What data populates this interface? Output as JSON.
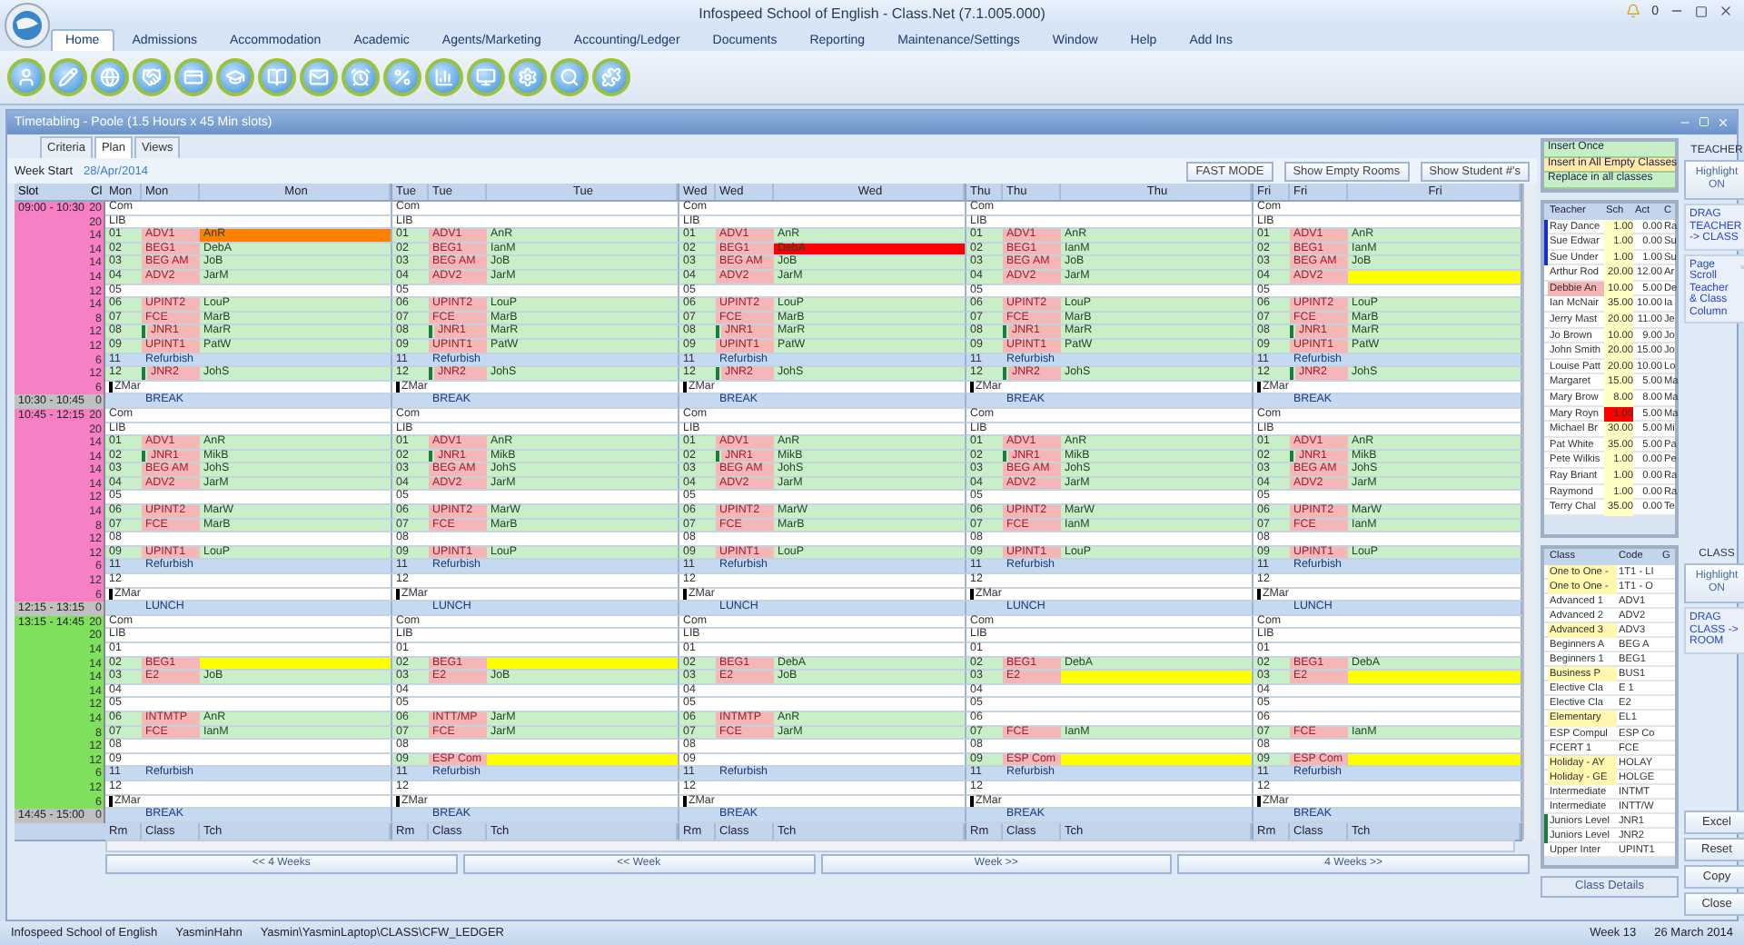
{
  "window": {
    "title": "Infospeed School of English - Class.Net (7.1.005.000)",
    "notification_count": "0"
  },
  "menu": [
    {
      "label": "Home",
      "selected": true
    },
    {
      "label": "Admissions",
      "selected": false
    },
    {
      "label": "Accommodation",
      "selected": false
    },
    {
      "label": "Academic",
      "selected": false
    },
    {
      "label": "Agents/Marketing",
      "selected": false
    },
    {
      "label": "Accounting/Ledger",
      "selected": false
    },
    {
      "label": "Documents",
      "selected": false
    },
    {
      "label": "Reporting",
      "selected": false
    },
    {
      "label": "Maintenance/Settings",
      "selected": false
    },
    {
      "label": "Window",
      "selected": false
    },
    {
      "label": "Help",
      "selected": false
    },
    {
      "label": "Add Ins",
      "selected": false
    }
  ],
  "timetable": {
    "title": "Timetabling - Poole (1.5 Hours x 45 Min slots)",
    "tabs": [
      {
        "label": "Criteria",
        "selected": false
      },
      {
        "label": "Plan",
        "selected": true
      },
      {
        "label": "Views",
        "selected": false
      }
    ],
    "week_start_label": "Week Start",
    "week_start": "28/Apr/2014",
    "buttons": [
      "FAST MODE",
      "Show Empty Rooms",
      "Show Student #'s"
    ],
    "slot_header": [
      "Slot",
      "Cl"
    ],
    "days": [
      {
        "headers": [
          "Mon",
          "Mon",
          "Mon"
        ],
        "footer": [
          "Rm",
          "Class",
          "Tch"
        ]
      },
      {
        "headers": [
          "Tue",
          "Tue",
          "Tue"
        ],
        "footer": [
          "Rm",
          "Class",
          "Tch"
        ]
      },
      {
        "headers": [
          "Wed",
          "Wed",
          "Wed"
        ],
        "footer": [
          "Rm",
          "Class",
          "Tch"
        ]
      },
      {
        "headers": [
          "Thu",
          "Thu",
          "Thu"
        ],
        "footer": [
          "Rm",
          "Class",
          "Tch"
        ]
      },
      {
        "headers": [
          "Fri",
          "Fri",
          "Fri"
        ],
        "footer": [
          "Rm",
          "Class",
          "Tch"
        ]
      }
    ],
    "slots": [
      {
        "time": "09:00 - 10:30",
        "color": "#f77fc4",
        "rows": [
          {
            "kind": "room",
            "cl": "20",
            "cells": [
              {
                "room": "Com"
              },
              {
                "room": "Com"
              },
              {
                "room": "Com"
              },
              {
                "room": "Com"
              },
              {
                "room": "Com"
              }
            ]
          },
          {
            "kind": "room",
            "cl": "20",
            "cells": [
              {
                "room": "LIB"
              },
              {
                "room": "LIB"
              },
              {
                "room": "LIB"
              },
              {
                "room": "LIB"
              },
              {
                "room": "LIB"
              }
            ]
          },
          {
            "kind": "room",
            "cl": "14",
            "cells": [
              {
                "room": "01",
                "class": "ADV1",
                "teacher": "AnR",
                "color": "#ff8000"
              },
              {
                "room": "01",
                "class": "ADV1",
                "teacher": "AnR"
              },
              {
                "room": "01",
                "class": "ADV1",
                "teacher": "AnR"
              },
              {
                "room": "01",
                "class": "ADV1",
                "teacher": "AnR"
              },
              {
                "room": "01",
                "class": "ADV1",
                "teacher": "AnR"
              }
            ]
          },
          {
            "kind": "room",
            "cl": "14",
            "cells": [
              {
                "room": "02",
                "class": "BEG1",
                "teacher": "DebA"
              },
              {
                "room": "02",
                "class": "BEG1",
                "teacher": "IanM"
              },
              {
                "room": "02",
                "class": "BEG1",
                "teacher": "DebA",
                "color": "#ff0000"
              },
              {
                "room": "02",
                "class": "BEG1",
                "teacher": "IanM"
              },
              {
                "room": "02",
                "class": "BEG1",
                "teacher": "IanM"
              }
            ]
          },
          {
            "kind": "room",
            "cl": "14",
            "cells": [
              {
                "room": "03",
                "class": "BEG AM",
                "teacher": "JoB"
              },
              {
                "room": "03",
                "class": "BEG AM",
                "teacher": "JoB"
              },
              {
                "room": "03",
                "class": "BEG AM",
                "teacher": "JoB"
              },
              {
                "room": "03",
                "class": "BEG AM",
                "teacher": "JoB"
              },
              {
                "room": "03",
                "class": "BEG AM",
                "teacher": "JoB"
              }
            ]
          },
          {
            "kind": "room",
            "cl": "14",
            "cells": [
              {
                "room": "04",
                "class": "ADV2",
                "teacher": "JarM"
              },
              {
                "room": "04",
                "class": "ADV2",
                "teacher": "JarM"
              },
              {
                "room": "04",
                "class": "ADV2",
                "teacher": "JarM"
              },
              {
                "room": "04",
                "class": "ADV2",
                "teacher": "JarM"
              },
              {
                "room": "04",
                "class": "ADV2",
                "color": "#ffff00"
              }
            ]
          },
          {
            "kind": "room",
            "cl": "12",
            "cells": [
              {
                "room": "05"
              },
              {
                "room": "05"
              },
              {
                "room": "05"
              },
              {
                "room": "05"
              },
              {
                "room": "05"
              }
            ]
          },
          {
            "kind": "room",
            "cl": "14",
            "cells": [
              {
                "room": "06",
                "class": "UPINT2",
                "teacher": "LouP"
              },
              {
                "room": "06",
                "class": "UPINT2",
                "teacher": "LouP"
              },
              {
                "room": "06",
                "class": "UPINT2",
                "teacher": "LouP"
              },
              {
                "room": "06",
                "class": "UPINT2",
                "teacher": "LouP"
              },
              {
                "room": "06",
                "class": "UPINT2",
                "teacher": "LouP"
              }
            ]
          },
          {
            "kind": "room",
            "cl": "8",
            "cells": [
              {
                "room": "07",
                "class": "FCE",
                "teacher": "MarB"
              },
              {
                "room": "07",
                "class": "FCE",
                "teacher": "MarB"
              },
              {
                "room": "07",
                "class": "FCE",
                "teacher": "MarB"
              },
              {
                "room": "07",
                "class": "FCE",
                "teacher": "MarB"
              },
              {
                "room": "07",
                "class": "FCE",
                "teacher": "MarB"
              }
            ]
          },
          {
            "kind": "room",
            "cl": "12",
            "cells": [
              {
                "room": "08",
                "class": "JNR1",
                "teacher": "MarR",
                "flagged": true
              },
              {
                "room": "08",
                "class": "JNR1",
                "teacher": "MarR",
                "flagged": true
              },
              {
                "room": "08",
                "class": "JNR1",
                "teacher": "MarR",
                "flagged": true
              },
              {
                "room": "08",
                "class": "JNR1",
                "teacher": "MarR",
                "flagged": true
              },
              {
                "room": "08",
                "class": "JNR1",
                "teacher": "MarR",
                "flagged": true
              }
            ]
          },
          {
            "kind": "room",
            "cl": "12",
            "cells": [
              {
                "room": "09",
                "class": "UPINT1",
                "teacher": "PatW"
              },
              {
                "room": "09",
                "class": "UPINT1",
                "teacher": "PatW"
              },
              {
                "room": "09",
                "class": "UPINT1",
                "teacher": "PatW"
              },
              {
                "room": "09",
                "class": "UPINT1",
                "teacher": "PatW"
              },
              {
                "room": "09",
                "class": "UPINT1",
                "teacher": "PatW"
              }
            ]
          },
          {
            "kind": "note",
            "cl": "6",
            "cells": [
              {
                "room": "11",
                "class": "Refurbish"
              },
              {
                "room": "11",
                "class": "Refurbish"
              },
              {
                "room": "11",
                "class": "Refurbish"
              },
              {
                "room": "11",
                "class": "Refurbish"
              },
              {
                "room": "11",
                "class": "Refurbish"
              }
            ]
          },
          {
            "kind": "room",
            "cl": "12",
            "cells": [
              {
                "room": "12",
                "class": "JNR2",
                "teacher": "JohS",
                "flagged": true
              },
              {
                "room": "12",
                "class": "JNR2",
                "teacher": "JohS",
                "flagged": true
              },
              {
                "room": "12",
                "class": "JNR2",
                "teacher": "JohS",
                "flagged": true
              },
              {
                "room": "12",
                "class": "JNR2",
                "teacher": "JohS",
                "flagged": true
              },
              {
                "room": "12",
                "class": "JNR2",
                "teacher": "JohS",
                "flagged": true
              }
            ]
          },
          {
            "kind": "room",
            "cl": "6",
            "cells": [
              {
                "room": "ZMar",
                "flagged": true
              },
              {
                "room": "ZMar",
                "flagged": true
              },
              {
                "room": "ZMar",
                "flagged": true
              },
              {
                "room": "ZMar",
                "flagged": true
              },
              {
                "room": "ZMar",
                "flagged": true
              }
            ]
          }
        ]
      },
      {
        "time": "10:30 - 10:45",
        "color": "#c0c0c0",
        "rows": [
          {
            "kind": "break",
            "cl": "0",
            "cells": [
              {
                "class": "BREAK"
              },
              {
                "class": "BREAK"
              },
              {
                "class": "BREAK"
              },
              {
                "class": "BREAK"
              },
              {
                "class": "BREAK"
              }
            ]
          }
        ]
      },
      {
        "time": "10:45 - 12:15",
        "color": "#f77fc4",
        "rows": [
          {
            "kind": "room",
            "cl": "20",
            "cells": [
              {
                "room": "Com"
              },
              {
                "room": "Com"
              },
              {
                "room": "Com"
              },
              {
                "room": "Com"
              },
              {
                "room": "Com"
              }
            ]
          },
          {
            "kind": "room",
            "cl": "20",
            "cells": [
              {
                "room": "LIB"
              },
              {
                "room": "LIB"
              },
              {
                "room": "LIB"
              },
              {
                "room": "LIB"
              },
              {
                "room": "LIB"
              }
            ]
          },
          {
            "kind": "room",
            "cl": "14",
            "cells": [
              {
                "room": "01",
                "class": "ADV1",
                "teacher": "AnR"
              },
              {
                "room": "01",
                "class": "ADV1",
                "teacher": "AnR"
              },
              {
                "room": "01",
                "class": "ADV1",
                "teacher": "AnR"
              },
              {
                "room": "01",
                "class": "ADV1",
                "teacher": "AnR"
              },
              {
                "room": "01",
                "class": "ADV1",
                "teacher": "AnR"
              }
            ]
          },
          {
            "kind": "room",
            "cl": "14",
            "cells": [
              {
                "room": "02",
                "class": "JNR1",
                "teacher": "MikB",
                "flagged": true
              },
              {
                "room": "02",
                "class": "JNR1",
                "teacher": "MikB",
                "flagged": true
              },
              {
                "room": "02",
                "class": "JNR1",
                "teacher": "MikB",
                "flagged": true
              },
              {
                "room": "02",
                "class": "JNR1",
                "teacher": "MikB",
                "flagged": true
              },
              {
                "room": "02",
                "class": "JNR1",
                "teacher": "MikB",
                "flagged": true
              }
            ]
          },
          {
            "kind": "room",
            "cl": "14",
            "cells": [
              {
                "room": "03",
                "class": "BEG AM",
                "teacher": "JohS"
              },
              {
                "room": "03",
                "class": "BEG AM",
                "teacher": "JohS"
              },
              {
                "room": "03",
                "class": "BEG AM",
                "teacher": "JohS"
              },
              {
                "room": "03",
                "class": "BEG AM",
                "teacher": "JohS"
              },
              {
                "room": "03",
                "class": "BEG AM",
                "teacher": "JohS"
              }
            ]
          },
          {
            "kind": "room",
            "cl": "14",
            "cells": [
              {
                "room": "04",
                "class": "ADV2",
                "teacher": "JarM"
              },
              {
                "room": "04",
                "class": "ADV2",
                "teacher": "JarM"
              },
              {
                "room": "04",
                "class": "ADV2",
                "teacher": "JarM"
              },
              {
                "room": "04",
                "class": "ADV2",
                "teacher": "JarM"
              },
              {
                "room": "04",
                "class": "ADV2",
                "teacher": "JarM"
              }
            ]
          },
          {
            "kind": "room",
            "cl": "12",
            "cells": [
              {
                "room": "05"
              },
              {
                "room": "05"
              },
              {
                "room": "05"
              },
              {
                "room": "05"
              },
              {
                "room": "05"
              }
            ]
          },
          {
            "kind": "room",
            "cl": "14",
            "cells": [
              {
                "room": "06",
                "class": "UPINT2",
                "teacher": "MarW"
              },
              {
                "room": "06",
                "class": "UPINT2",
                "teacher": "MarW"
              },
              {
                "room": "06",
                "class": "UPINT2",
                "teacher": "MarW"
              },
              {
                "room": "06",
                "class": "UPINT2",
                "teacher": "MarW"
              },
              {
                "room": "06",
                "class": "UPINT2",
                "teacher": "MarW"
              }
            ]
          },
          {
            "kind": "room",
            "cl": "8",
            "cells": [
              {
                "room": "07",
                "class": "FCE",
                "teacher": "MarB"
              },
              {
                "room": "07",
                "class": "FCE",
                "teacher": "MarB"
              },
              {
                "room": "07",
                "class": "FCE",
                "teacher": "MarB"
              },
              {
                "room": "07",
                "class": "FCE",
                "teacher": "IanM"
              },
              {
                "room": "07",
                "class": "FCE",
                "teacher": "IanM"
              }
            ]
          },
          {
            "kind": "room",
            "cl": "12",
            "cells": [
              {
                "room": "08"
              },
              {
                "room": "08"
              },
              {
                "room": "08"
              },
              {
                "room": "08"
              },
              {
                "room": "08"
              }
            ]
          },
          {
            "kind": "room",
            "cl": "12",
            "cells": [
              {
                "room": "09",
                "class": "UPINT1",
                "teacher": "LouP"
              },
              {
                "room": "09",
                "class": "UPINT1",
                "teacher": "LouP"
              },
              {
                "room": "09",
                "class": "UPINT1",
                "teacher": "LouP"
              },
              {
                "room": "09",
                "class": "UPINT1",
                "teacher": "LouP"
              },
              {
                "room": "09",
                "class": "UPINT1",
                "teacher": "LouP"
              }
            ]
          },
          {
            "kind": "note",
            "cl": "6",
            "cells": [
              {
                "room": "11",
                "class": "Refurbish"
              },
              {
                "room": "11",
                "class": "Refurbish"
              },
              {
                "room": "11",
                "class": "Refurbish"
              },
              {
                "room": "11",
                "class": "Refurbish"
              },
              {
                "room": "11",
                "class": "Refurbish"
              }
            ]
          },
          {
            "kind": "room",
            "cl": "12",
            "cells": [
              {
                "room": "12"
              },
              {
                "room": "12"
              },
              {
                "room": "12"
              },
              {
                "room": "12"
              },
              {
                "room": "12"
              }
            ]
          },
          {
            "kind": "room",
            "cl": "6",
            "cells": [
              {
                "room": "ZMar",
                "flagged": true
              },
              {
                "room": "ZMar",
                "flagged": true
              },
              {
                "room": "ZMar",
                "flagged": true
              },
              {
                "room": "ZMar",
                "flagged": true
              },
              {
                "room": "ZMar",
                "flagged": true
              }
            ]
          }
        ]
      },
      {
        "time": "12:15 - 13:15",
        "color": "#c0c0c0",
        "rows": [
          {
            "kind": "break",
            "cl": "0",
            "cells": [
              {
                "class": "LUNCH"
              },
              {
                "class": "LUNCH"
              },
              {
                "class": "LUNCH"
              },
              {
                "class": "LUNCH"
              },
              {
                "class": "LUNCH"
              }
            ]
          }
        ]
      },
      {
        "time": "13:15 - 14:45",
        "color": "#7ee05c",
        "rows": [
          {
            "kind": "room",
            "cl": "20",
            "cells": [
              {
                "room": "Com"
              },
              {
                "room": "Com"
              },
              {
                "room": "Com"
              },
              {
                "room": "Com"
              },
              {
                "room": "Com"
              }
            ]
          },
          {
            "kind": "room",
            "cl": "20",
            "cells": [
              {
                "room": "LIB"
              },
              {
                "room": "LIB"
              },
              {
                "room": "LIB"
              },
              {
                "room": "LIB"
              },
              {
                "room": "LIB"
              }
            ]
          },
          {
            "kind": "room",
            "cl": "14",
            "cells": [
              {
                "room": "01"
              },
              {
                "room": "01"
              },
              {
                "room": "01"
              },
              {
                "room": "01"
              },
              {
                "room": "01"
              }
            ]
          },
          {
            "kind": "room",
            "cl": "14",
            "cells": [
              {
                "room": "02",
                "class": "BEG1",
                "color": "#ffff00"
              },
              {
                "room": "02",
                "class": "BEG1",
                "color": "#ffff00"
              },
              {
                "room": "02",
                "class": "BEG1",
                "teacher": "DebA"
              },
              {
                "room": "02",
                "class": "BEG1",
                "teacher": "DebA"
              },
              {
                "room": "02",
                "class": "BEG1",
                "teacher": "DebA"
              }
            ]
          },
          {
            "kind": "room",
            "cl": "14",
            "cells": [
              {
                "room": "03",
                "class": "E2",
                "teacher": "JoB"
              },
              {
                "room": "03",
                "class": "E2",
                "teacher": "JoB"
              },
              {
                "room": "03",
                "class": "E2",
                "teacher": "JoB"
              },
              {
                "room": "03",
                "class": "E2",
                "color": "#ffff00"
              },
              {
                "room": "03",
                "class": "E2",
                "color": "#ffff00"
              }
            ]
          },
          {
            "kind": "room",
            "cl": "14",
            "cells": [
              {
                "room": "04"
              },
              {
                "room": "04"
              },
              {
                "room": "04"
              },
              {
                "room": "04"
              },
              {
                "room": "04"
              }
            ]
          },
          {
            "kind": "room",
            "cl": "12",
            "cells": [
              {
                "room": "05"
              },
              {
                "room": "05"
              },
              {
                "room": "05"
              },
              {
                "room": "05"
              },
              {
                "room": "05"
              }
            ]
          },
          {
            "kind": "room",
            "cl": "14",
            "cells": [
              {
                "room": "06",
                "class": "INTMTP",
                "teacher": "AnR"
              },
              {
                "room": "06",
                "class": "INTT/MP",
                "teacher": "JarM"
              },
              {
                "room": "06",
                "class": "INTMTP",
                "teacher": "AnR"
              },
              {
                "room": "06"
              },
              {
                "room": "06"
              }
            ]
          },
          {
            "kind": "room",
            "cl": "8",
            "cells": [
              {
                "room": "07",
                "class": "FCE",
                "teacher": "IanM"
              },
              {
                "room": "07",
                "class": "FCE",
                "teacher": "JarM"
              },
              {
                "room": "07",
                "class": "FCE",
                "teacher": "JarM"
              },
              {
                "room": "07",
                "class": "FCE",
                "teacher": "IanM"
              },
              {
                "room": "07",
                "class": "FCE",
                "teacher": "IanM"
              }
            ]
          },
          {
            "kind": "room",
            "cl": "12",
            "cells": [
              {
                "room": "08"
              },
              {
                "room": "08"
              },
              {
                "room": "08"
              },
              {
                "room": "08"
              },
              {
                "room": "08"
              }
            ]
          },
          {
            "kind": "room",
            "cl": "12",
            "cells": [
              {
                "room": "09"
              },
              {
                "room": "09",
                "class": "ESP Com",
                "color": "#ffff00"
              },
              {
                "room": "09"
              },
              {
                "room": "09",
                "class": "ESP Com",
                "color": "#ffff00"
              },
              {
                "room": "09",
                "class": "ESP Com",
                "color": "#ffff00"
              }
            ]
          },
          {
            "kind": "note",
            "cl": "6",
            "cells": [
              {
                "room": "11",
                "class": "Refurbish"
              },
              {
                "room": "11",
                "class": "Refurbish"
              },
              {
                "room": "11",
                "class": "Refurbish"
              },
              {
                "room": "11",
                "class": "Refurbish"
              },
              {
                "room": "11",
                "class": "Refurbish"
              }
            ]
          },
          {
            "kind": "room",
            "cl": "12",
            "cells": [
              {
                "room": "12"
              },
              {
                "room": "12"
              },
              {
                "room": "12"
              },
              {
                "room": "12"
              },
              {
                "room": "12"
              }
            ]
          },
          {
            "kind": "room",
            "cl": "6",
            "cells": [
              {
                "room": "ZMar",
                "flagged": true
              },
              {
                "room": "ZMar",
                "flagged": true
              },
              {
                "room": "ZMar",
                "flagged": true
              },
              {
                "room": "ZMar",
                "flagged": true
              },
              {
                "room": "ZMar",
                "flagged": true
              }
            ]
          }
        ]
      },
      {
        "time": "14:45 - 15:00",
        "color": "#c0c0c0",
        "rows": [
          {
            "kind": "break",
            "cl": "0",
            "cells": [
              {
                "class": "BREAK"
              },
              {
                "class": "BREAK"
              },
              {
                "class": "BREAK"
              },
              {
                "class": "BREAK"
              },
              {
                "class": "BREAK"
              }
            ]
          }
        ]
      }
    ],
    "nav": [
      "<< 4 Weeks",
      "<< Week",
      "Week >>",
      "4 Weeks >>"
    ]
  },
  "modes": [
    {
      "label": "Insert Once",
      "selected": false
    },
    {
      "label": "Insert in All Empty Classes",
      "selected": true
    },
    {
      "label": "Replace in all classes",
      "selected": false
    }
  ],
  "teachers": {
    "columns": [
      "Teacher",
      "Sch",
      "Act",
      "C"
    ],
    "rows": [
      {
        "name": "Ray Dance",
        "sch": "1.00",
        "act": "0.00",
        "column_4": "Ra",
        "flagged": true
      },
      {
        "name": "Sue Edwar",
        "sch": "1.00",
        "act": "0.00",
        "column_4": "Su",
        "flagged": true
      },
      {
        "name": "Sue Under",
        "sch": "1.00",
        "act": "1.00",
        "column_4": "Su",
        "flagged": true
      },
      {
        "name": "Arthur Rod",
        "sch": "20.00",
        "act": "12.00",
        "column_4": "Ar"
      },
      {
        "name": "Debbie An",
        "sch": "10.00",
        "act": "5.00",
        "column_4": "De",
        "color": "#f4b4b4"
      },
      {
        "name": "Ian McNair",
        "sch": "35.00",
        "act": "10.00",
        "column_4": "Ia"
      },
      {
        "name": "Jerry Mast",
        "sch": "20.00",
        "act": "11.00",
        "column_4": "Je"
      },
      {
        "name": "Jo Brown",
        "sch": "10.00",
        "act": "9.00",
        "column_4": "Jo"
      },
      {
        "name": "John Smith",
        "sch": "20.00",
        "act": "15.00",
        "column_4": "Jo"
      },
      {
        "name": "Louise Patt",
        "sch": "20.00",
        "act": "10.00",
        "column_4": "Lo"
      },
      {
        "name": "Margaret",
        "sch": "15.00",
        "act": "5.00",
        "column_4": "Ma"
      },
      {
        "name": "Mary Brow",
        "sch": "8.00",
        "act": "8.00",
        "column_4": "Ma"
      },
      {
        "name": "Mary Royn",
        "sch": "1.00",
        "act": "5.00",
        "column_4": "Ma",
        "sch_alert": true
      },
      {
        "name": "Michael Br",
        "sch": "30.00",
        "act": "5.00",
        "column_4": "Mi"
      },
      {
        "name": "Pat White",
        "sch": "35.00",
        "act": "5.00",
        "column_4": "Pa"
      },
      {
        "name": "Pete Wilkis",
        "sch": "1.00",
        "act": "0.00",
        "column_4": "Pe"
      },
      {
        "name": "Ray Briant",
        "sch": "1.00",
        "act": "0.00",
        "column_4": "Ra"
      },
      {
        "name": "Raymond",
        "sch": "1.00",
        "act": "0.00",
        "column_4": "Ra"
      },
      {
        "name": "Terry Chal",
        "sch": "35.00",
        "act": "0.00",
        "column_4": "Te"
      }
    ]
  },
  "classes": {
    "columns": [
      "Class",
      "Code",
      "G"
    ],
    "rows": [
      {
        "name": "One to One -",
        "code": "1T1 - LI",
        "highlighted": true
      },
      {
        "name": "One to One -",
        "code": "1T1 - O",
        "highlighted": true
      },
      {
        "name": "Advanced 1",
        "code": "ADV1",
        "highlighted": false
      },
      {
        "name": "Advanced 2",
        "code": "ADV2",
        "highlighted": false
      },
      {
        "name": "Advanced 3",
        "code": "ADV3",
        "highlighted": true
      },
      {
        "name": "Beginners A",
        "code": "BEG A",
        "highlighted": false
      },
      {
        "name": "Beginners 1",
        "code": "BEG1",
        "highlighted": false
      },
      {
        "name": "Business P",
        "code": "BUS1",
        "highlighted": true
      },
      {
        "name": "Elective Cla",
        "code": "E 1",
        "highlighted": false
      },
      {
        "name": "Elective Cla",
        "code": "E2",
        "highlighted": false
      },
      {
        "name": "Elementary",
        "code": "EL1",
        "highlighted": true
      },
      {
        "name": "ESP Compul",
        "code": "ESP Co",
        "highlighted": false
      },
      {
        "name": "FCERT 1",
        "code": "FCE",
        "highlighted": false
      },
      {
        "name": "Holiday - AY",
        "code": "HOLAY",
        "highlighted": true
      },
      {
        "name": "Holiday - GE",
        "code": "HOLGE",
        "highlighted": true
      },
      {
        "name": "Intermediate",
        "code": "INTMT",
        "highlighted": false
      },
      {
        "name": "Intermediate",
        "code": "INTT/W",
        "highlighted": false
      },
      {
        "name": "Juniors Level",
        "code": "JNR1",
        "highlighted": false,
        "flagged": true
      },
      {
        "name": "Juniors Level",
        "code": "JNR2",
        "highlighted": false,
        "flagged": true
      },
      {
        "name": "Upper Inter",
        "code": "UPINT1",
        "highlighted": false
      }
    ],
    "details_button": "Class Details"
  },
  "side": {
    "teacher_label": "TEACHER",
    "teacher_highlight": "Highlight ON",
    "teacher_drag": "DRAG TEACHER -> CLASS",
    "scroll_note": "Page Scroll Teacher & Class Column",
    "class_label": "CLASS",
    "class_highlight": "Highlight ON",
    "class_drag": "DRAG CLASS -> ROOM",
    "buttons": [
      "Excel",
      "Reset",
      "Copy",
      "Close"
    ]
  },
  "status_bar": {
    "left": [
      "Infospeed School of English",
      "YasminHahn",
      "Yasmin\\YasminLaptop\\CLASS\\CFW_LEDGER"
    ],
    "right": [
      "Week 13",
      "26 March 2014"
    ]
  }
}
